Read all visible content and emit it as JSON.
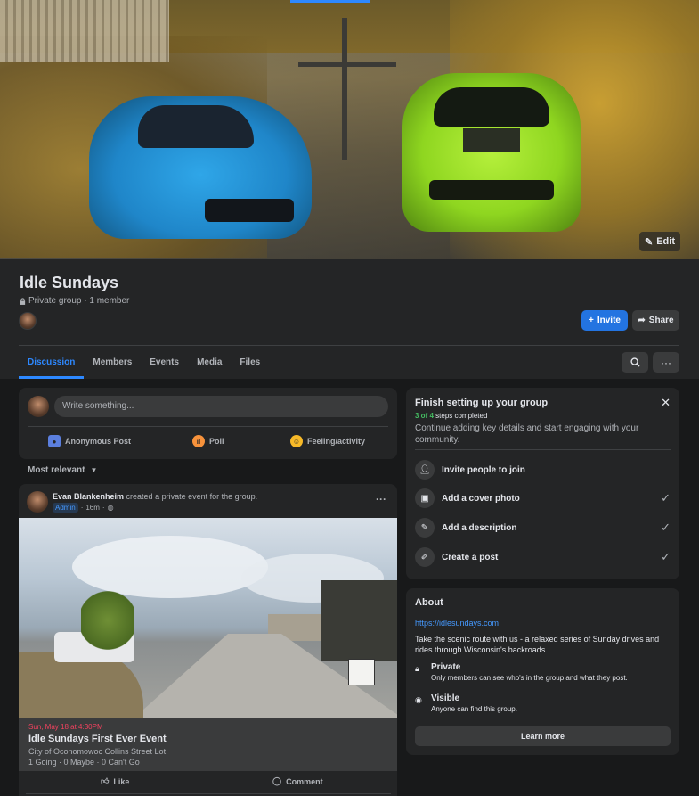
{
  "header": {
    "edit_label": "Edit",
    "group_name": "Idle Sundays",
    "privacy_meta": "Private group · 1 member",
    "invite_label": "Invite",
    "share_label": "Share"
  },
  "tabs": [
    {
      "label": "Discussion",
      "active": true
    },
    {
      "label": "Members"
    },
    {
      "label": "Events"
    },
    {
      "label": "Media"
    },
    {
      "label": "Files"
    }
  ],
  "composer": {
    "placeholder": "Write something...",
    "actions": [
      "Anonymous Post",
      "Poll",
      "Feeling/activity"
    ]
  },
  "sort": {
    "label": "Most relevant"
  },
  "post": {
    "author": "Evan Blankenheim",
    "action": "created a private event for the group.",
    "badge": "Admin",
    "time": "16m",
    "event": {
      "date": "Sun, May 18 at 4:30PM",
      "name": "Idle Sundays First Ever Event",
      "location": "City of Oconomowoc Collins Street Lot",
      "rsvp": "1 Going · 0 Maybe · 0 Can't Go"
    },
    "like_label": "Like",
    "comment_label": "Comment"
  },
  "setup": {
    "title": "Finish setting up your group",
    "progress_done": "3 of 4",
    "progress_rest": "steps completed",
    "description": "Continue adding key details and start engaging with your community.",
    "steps": [
      {
        "label": "Invite people to join",
        "done": false
      },
      {
        "label": "Add a cover photo",
        "done": true
      },
      {
        "label": "Add a description",
        "done": true
      },
      {
        "label": "Create a post",
        "done": true
      }
    ]
  },
  "about": {
    "title": "About",
    "url": "https://idlesundays.com",
    "description": "Take the scenic route with us - a relaxed series of Sunday drives and rides through Wisconsin's backroads.",
    "private_title": "Private",
    "private_desc": "Only members can see who's in the group and what they post.",
    "visible_title": "Visible",
    "visible_desc": "Anyone can find this group.",
    "learn_more": "Learn more"
  },
  "colors": {
    "accent": "#2374e1",
    "progress_green": "#45bd62",
    "event_date": "#f3425f"
  }
}
